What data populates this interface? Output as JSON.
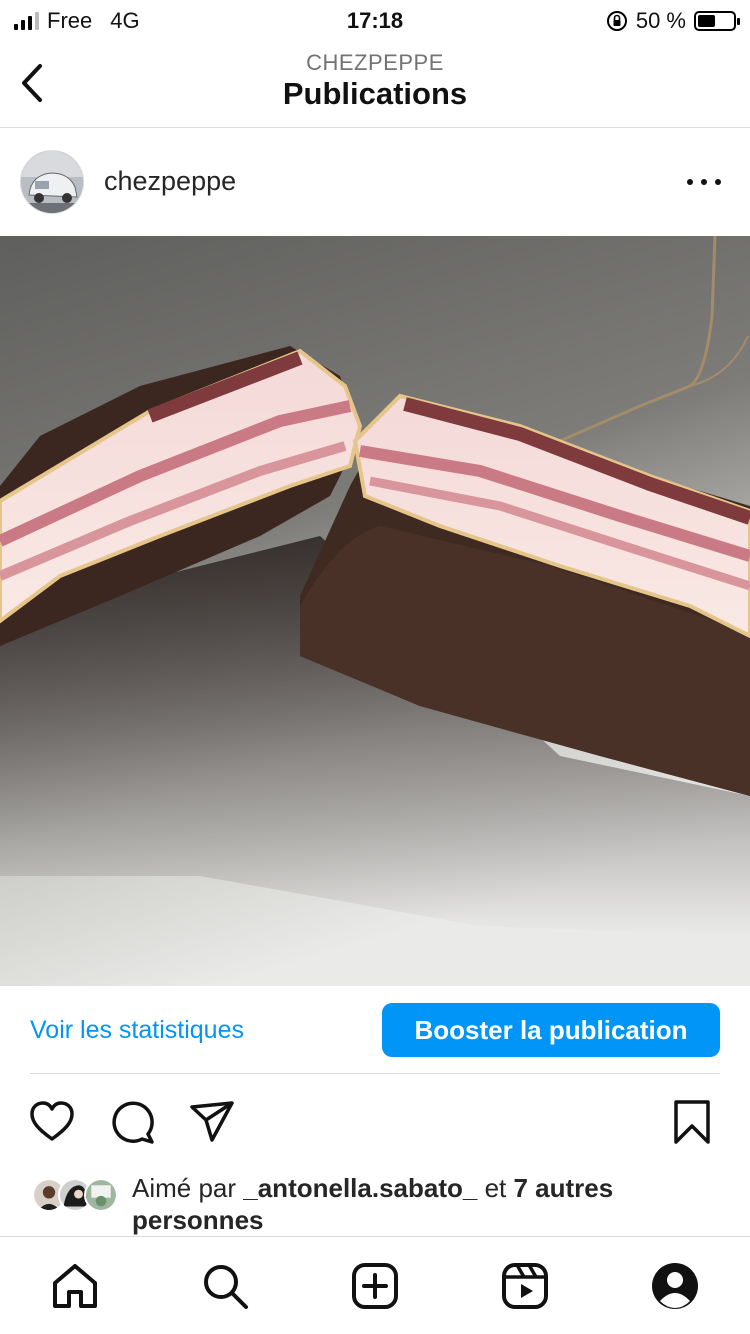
{
  "status_bar": {
    "carrier": "Free",
    "network": "4G",
    "time": "17:18",
    "battery_percent": "50 %",
    "battery_level": 0.5,
    "icons": [
      "signal-icon",
      "orientation-lock-icon",
      "battery-icon"
    ]
  },
  "header": {
    "account": "CHEZPEPPE",
    "title": "Publications",
    "back_icon": "chevron-left-icon"
  },
  "post": {
    "username": "chezpeppe",
    "more_icon": "ellipsis-icon",
    "image_description_icon": "photo",
    "stats_label": "Voir les statistiques",
    "boost_label": "Booster la publication",
    "likes_prefix": "Aimé par ",
    "liked_by": "_antonella.sabato_",
    "likes_middle": " et ",
    "likes_others": "7 autres personnes"
  },
  "actions": [
    "heart-icon",
    "comment-icon",
    "share-icon",
    "bookmark-icon"
  ],
  "tabbar": [
    "home-icon",
    "search-icon",
    "create-icon",
    "reels-icon",
    "profile-icon"
  ],
  "colors": {
    "accent": "#0095f6",
    "divider": "#dbdbdb",
    "text": "#262626"
  }
}
